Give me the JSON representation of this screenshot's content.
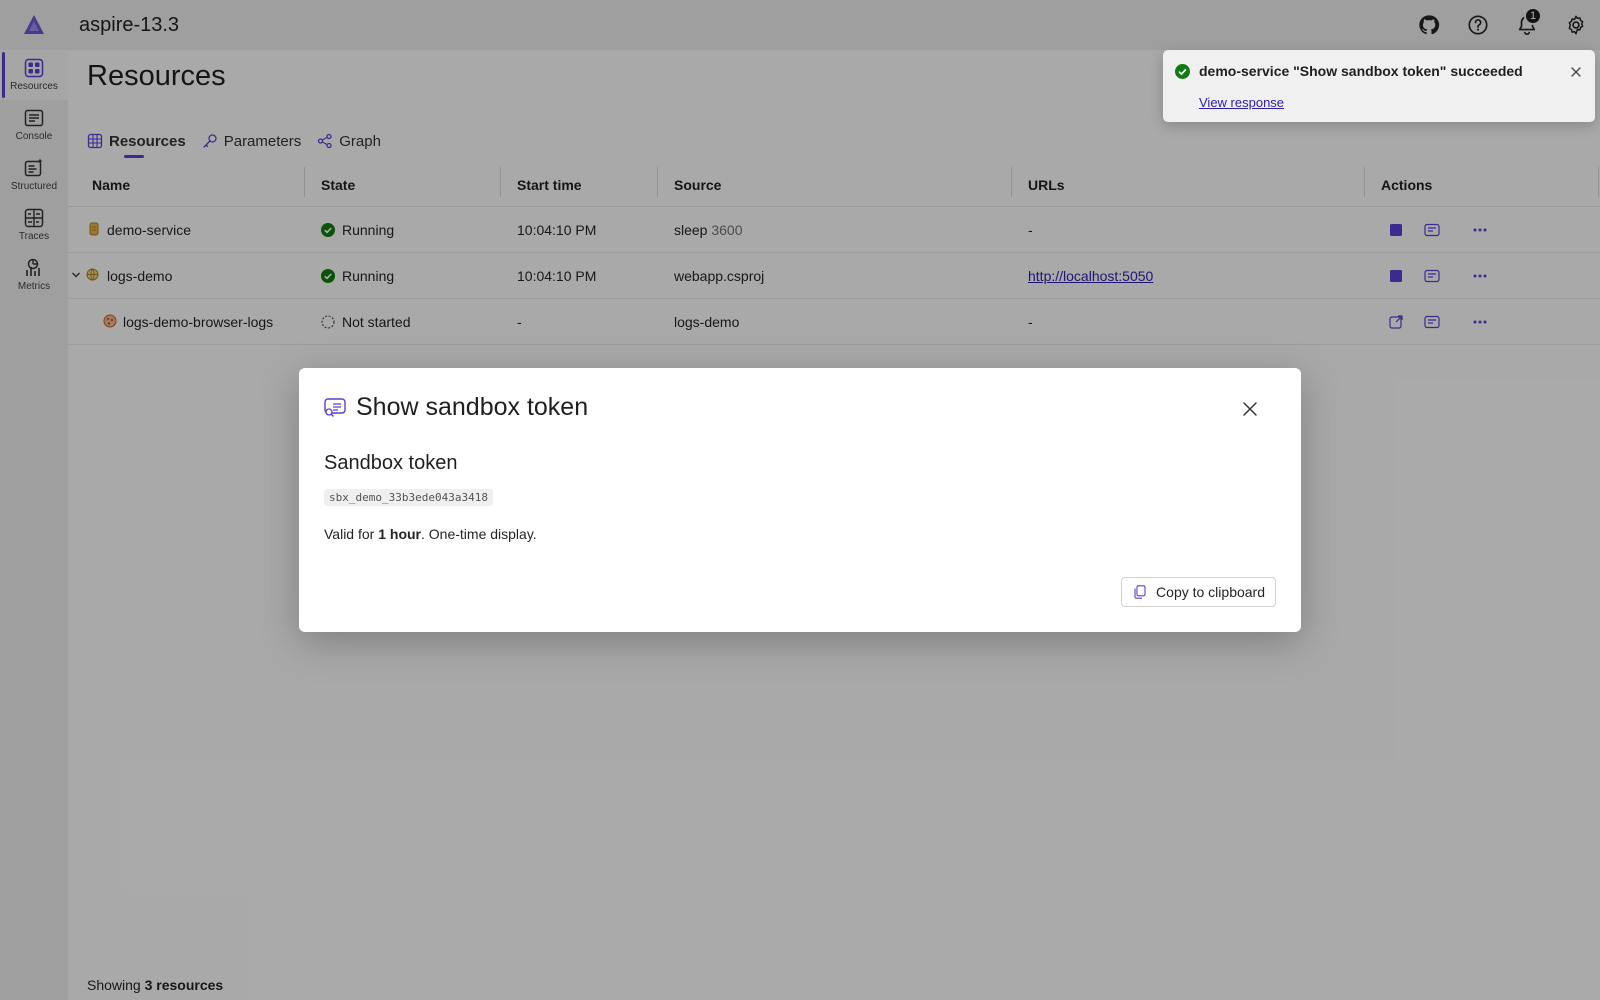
{
  "app": {
    "title": "aspire-13.3"
  },
  "nav": {
    "items": [
      {
        "label": "Resources",
        "icon": "resources-icon"
      },
      {
        "label": "Console",
        "icon": "console-icon"
      },
      {
        "label": "Structured",
        "icon": "structured-icon"
      },
      {
        "label": "Traces",
        "icon": "traces-icon"
      },
      {
        "label": "Metrics",
        "icon": "metrics-icon"
      }
    ]
  },
  "header": {
    "notification_count": "1"
  },
  "page": {
    "title": "Resources",
    "tabs": [
      {
        "label": "Resources",
        "icon": "grid-icon"
      },
      {
        "label": "Parameters",
        "icon": "key-icon"
      },
      {
        "label": "Graph",
        "icon": "graph-icon"
      }
    ]
  },
  "table": {
    "columns": [
      "Name",
      "State",
      "Start time",
      "Source",
      "URLs",
      "Actions"
    ],
    "rows": [
      {
        "name": "demo-service",
        "state": "Running",
        "start": "10:04:10 PM",
        "source_main": "sleep",
        "source_extra": "3600",
        "url": "-"
      },
      {
        "name": "logs-demo",
        "state": "Running",
        "start": "10:04:10 PM",
        "source_main": "webapp.csproj",
        "source_extra": "",
        "url": "http://localhost:5050"
      },
      {
        "name": "logs-demo-browser-logs",
        "state": "Not started",
        "start": "-",
        "source_main": "logs-demo",
        "source_extra": "",
        "url": "-"
      }
    ]
  },
  "footer": {
    "prefix": "Showing",
    "count": "3 resources"
  },
  "dialog": {
    "title": "Show sandbox token",
    "heading": "Sandbox token",
    "token": "sbx_demo_33b3ede043a3418",
    "valid_prefix": "Valid for",
    "valid_bold": "1 hour",
    "valid_suffix": ". One-time display.",
    "copy_label": "Copy to clipboard"
  },
  "toast": {
    "message": "demo-service \"Show sandbox token\" succeeded",
    "link": "View response"
  },
  "colors": {
    "accent": "#5b3fd1",
    "success": "#107c10",
    "link": "#2c1fa8"
  }
}
